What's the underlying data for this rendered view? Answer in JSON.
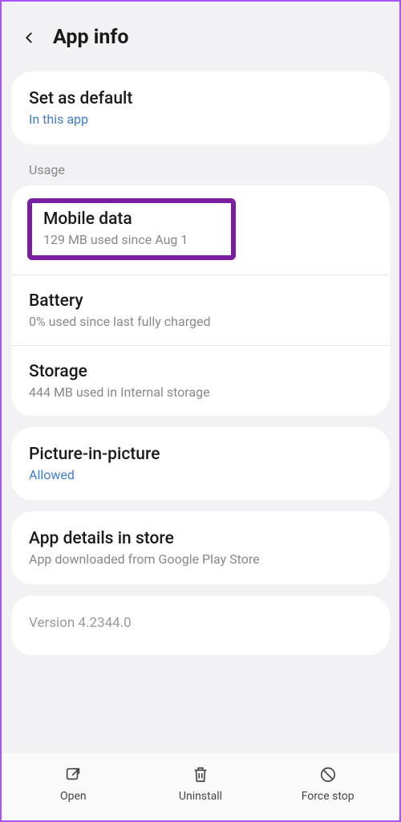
{
  "header": {
    "title": "App info"
  },
  "defaults": {
    "title": "Set as default",
    "sub": "In this app"
  },
  "section_usage_label": "Usage",
  "usage": {
    "mobile_data": {
      "title": "Mobile data",
      "sub": "129 MB used since Aug 1"
    },
    "battery": {
      "title": "Battery",
      "sub": "0% used since last fully charged"
    },
    "storage": {
      "title": "Storage",
      "sub": "444 MB used in Internal storage"
    }
  },
  "pip": {
    "title": "Picture-in-picture",
    "sub": "Allowed"
  },
  "store": {
    "title": "App details in store",
    "sub": "App downloaded from Google Play Store"
  },
  "version": "Version 4.2344.0",
  "bottom": {
    "open": "Open",
    "uninstall": "Uninstall",
    "force_stop": "Force stop"
  }
}
